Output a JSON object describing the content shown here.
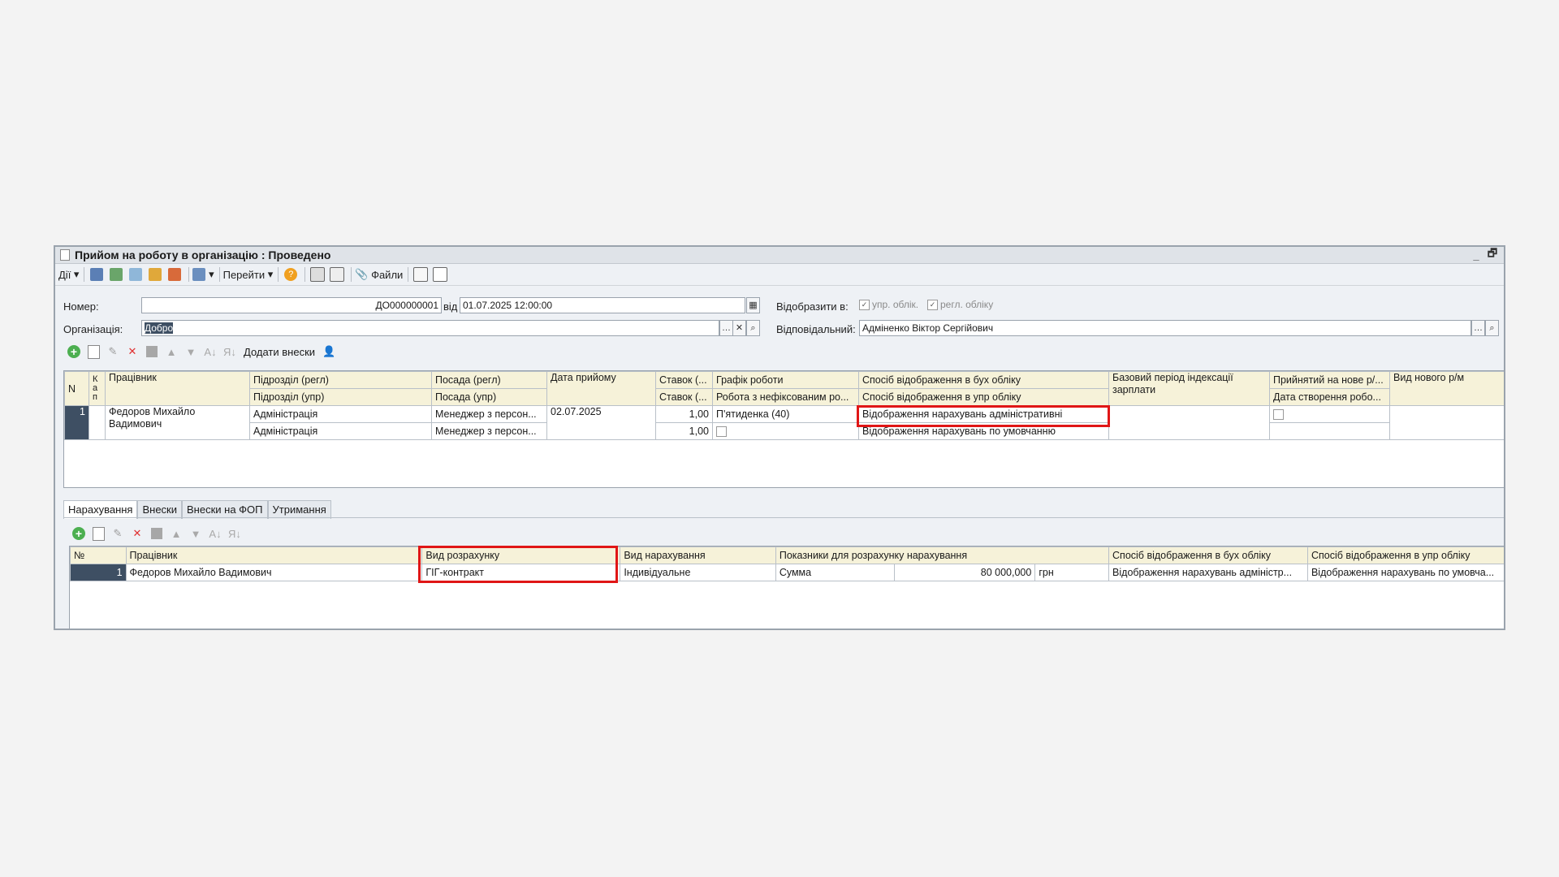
{
  "window": {
    "title": "Прийом на роботу в організацію : Проведено",
    "minimize": "_",
    "restore": "🗗"
  },
  "toolbar": {
    "actions": "Дії",
    "goto": "Перейти",
    "files": "Файли"
  },
  "form": {
    "number_label": "Номер:",
    "number_value": "ДО000000001",
    "from_label": "від",
    "date_value": "01.07.2025 12:00:00",
    "org_label": "Організація:",
    "org_value": "Добро",
    "show_in_label": "Відобразити в:",
    "upr_label": "упр. облік.",
    "regl_label": "регл. обліку",
    "resp_label": "Відповідальний:",
    "resp_value": "Адміненко Віктор Сергійович"
  },
  "employees_toolbar": {
    "add_contrib": "Додати внески"
  },
  "employees": {
    "headers_top": [
      "N",
      "К а п",
      "Працівник",
      "Підрозділ (регл)",
      "Посада (регл)",
      "Дата прийому",
      "Ставок (...",
      "Графік роботи",
      "Спосіб відображення в бух обліку",
      "Базовий період індексації зарплати",
      "Прийнятий на нове р/...",
      "Вид нового р/м"
    ],
    "headers_bottom": [
      "Підрозділ (упр)",
      "Посада (упр)",
      "Ставок (...",
      "Робота з нефіксованим ро...",
      "Спосіб відображення в упр обліку",
      "Дата створення робо..."
    ],
    "row": {
      "n": "1",
      "employee": "Федоров Михайло Вадимович",
      "dept_regl": "Адміністрація",
      "pos_regl": "Менеджер з персон...",
      "hire_date": "02.07.2025",
      "rate_regl": "1,00",
      "schedule": "П'ятиденка (40)",
      "acc_bux": "Відображення нарахувань адміністративні",
      "dept_upr": "Адміністрація",
      "pos_upr": "Менеджер з персон...",
      "rate_upr": "1,00",
      "acc_upr": "Відображення нарахувань по умовчанню"
    }
  },
  "tabs": [
    "Нарахування",
    "Внески",
    "Внески на ФОП",
    "Утримання"
  ],
  "accruals": {
    "headers": [
      "№",
      "Працівник",
      "Вид розрахунку",
      "Вид нарахування",
      "Показники для розрахунку нарахування",
      "Спосіб відображення в бух обліку",
      "Спосіб відображення в упр обліку"
    ],
    "row": {
      "n": "1",
      "employee": "Федоров Михайло Вадимович",
      "calc_type": "ГІГ-контракт",
      "accrual_type": "Індивідуальне",
      "indicator": "Сумма",
      "amount": "80 000,000",
      "currency": "грн",
      "acc_bux": "Відображення нарахувань адміністр...",
      "acc_upr": "Відображення нарахувань по умовча..."
    }
  },
  "colors": {
    "highlight": "#e01616",
    "header_bg": "#f6f2d9",
    "selection": "#3e4f63"
  }
}
